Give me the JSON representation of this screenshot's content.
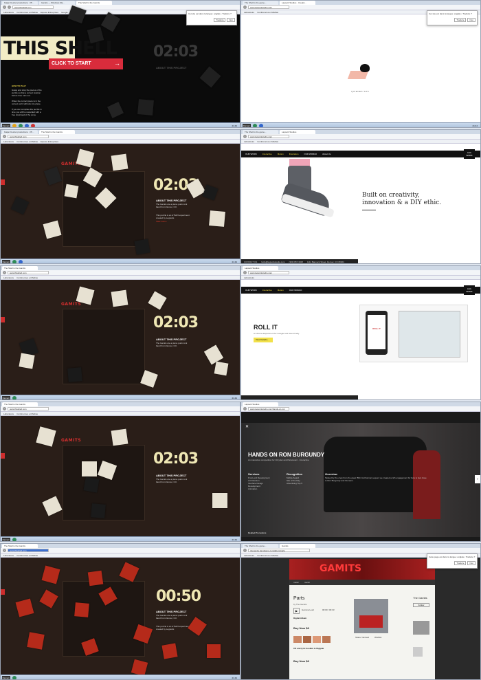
{
  "browser": {
    "tabs_a": [
      "Kaijan Kestrel productions · Ph...",
      "Gamits — Windows Ma...",
      "The Shell Is the Gamits",
      "The Shell is the game...",
      "The Shell is the Gamits"
    ],
    "tabs_b": [
      "Lapsetti Studios · Creativ...",
      "Gamits",
      "Lapsetti Studios"
    ],
    "bookmarks": [
      "Laboratoire",
      "Conférences et Médias",
      "Espace Entreprises",
      "Google",
      "Développer Google+ ou...",
      "DIGI"
    ],
    "search_box": "Sir Squirrel (Canadian) ▾",
    "gsearch": "Google"
  },
  "panel1": {
    "url": "www.thisshell.com",
    "title": "THIS SHELL",
    "cta": "CLICK TO START",
    "howto_title": "HOW TO PLAY",
    "howto_1": "Grasp and drop the pieces of the puzzle so that a correct location before time runs out.",
    "howto_2": "When the correct piece is in the correct cell it will lock into place.",
    "howto_3": "If you can complete the puzzle in time you will be rewarded with a free download of the song.",
    "timer": "02:03",
    "about_title": "ABOUT THIS PROJECT"
  },
  "panel2": {
    "url": "www.legworkstudio.com",
    "popup_text": "Cet site est dans la langue: anglais • Traduire ?",
    "popup_translate": "Traduire",
    "popup_no": "Non",
    "caption": "QUIENES SOS"
  },
  "panel3": {
    "url": "www.thisshell.com",
    "logo": "GAMITS",
    "timer": "02:03",
    "about_title": "ABOUT THIS PROJECT",
    "about_text": "The Gamits are a piano punk rock band from Denver, CO.",
    "about_text2": "This puzzle is an HTML5 experiment created by Legwork.",
    "about_link": "View more ›"
  },
  "panel4": {
    "url": "www.legworkstudio.com",
    "nav": [
      "OUR WORK",
      "Interactive",
      "Motion",
      "Illustration",
      "OUR WORLD",
      "About Us",
      "Team Forms",
      "Entertainment"
    ],
    "headline": "Built on creativity, innovation & a DIY ethic.",
    "contact": "CONTACT US",
    "email": "hello@legworkstudio.com",
    "phone": "(303) 867-3025",
    "address": "1111 Bannock Street, Denver, CO 80204",
    "logo": "LEG WORK"
  },
  "panel5": {
    "url": "www.thisshell.com",
    "logo": "GAMITS",
    "timer": "02:03",
    "about_title": "ABOUT THIS PROJECT"
  },
  "panel6": {
    "url": "www.legworkstudio.com",
    "title": "ROLL IT",
    "subtitle": "A Chrome Experiment for Google and Sound Jelly",
    "btn": "View Details ›",
    "phone_text": "ROLL IT"
  },
  "panel7": {
    "url": "www.thisshell.com",
    "logo": "GAMITS",
    "timer": "02:03",
    "about_title": "ABOUT THIS PROJECT"
  },
  "panel8": {
    "url": "www.legworkstudio.com/hands-on-ron",
    "title": "HANDS ON RON BURGUNDY",
    "subtitle": "An interactive competition for Chrysler and Paramount · Interactive",
    "col1_title": "Services",
    "col1": [
      "Front-end Development",
      "Art Direction",
      "Interface Design",
      "Development",
      "Animation"
    ],
    "col2_title": "Recognition",
    "col2": [
      "Mobile Award",
      "Site of the Day",
      "Advertising Top 5"
    ],
    "col3_title": "Overview",
    "col3": "Tasked by the crew from the great 'BIG' Anchorman sequel, we created a rich engagement for fans to feel close to Ron Burgundy and his team.",
    "related": "Related Promotions"
  },
  "panel9": {
    "url": "www.thisshell.com",
    "timer": "00:50",
    "about_title": "ABOUT THIS PROJECT",
    "about_text": "The Gamits are a piano punk rock band from Denver, CO.",
    "about_text2": "This puzzle is an HTML5 experiment created by Legwork."
  },
  "panel10": {
    "url": "thegamits.bandcamp.com/album/parts",
    "popup_text": "Cette page est dans la langue: anglais • Traduire ?",
    "popup_translate": "Traduire",
    "popup_no": "Non",
    "banner": "GAMITS",
    "nav": [
      "music",
      "merch"
    ],
    "album": "Parts",
    "by": "by The Gamits",
    "track": "Gamma Lewl",
    "time": "00:00 / 03:33",
    "digital": "Digital Album",
    "buy": "Buy Now  $8",
    "buy2": "Buy Now  $8",
    "cd": "CD and lyric booklet in Digipak",
    "share": "Share / Embed",
    "wishlist": "Wishlist",
    "artist": "The Gamits",
    "follow": "Follow",
    "tracklist": "Parts Parts"
  },
  "taskbar": {
    "start": "Démarr.",
    "clock": "21:44"
  }
}
